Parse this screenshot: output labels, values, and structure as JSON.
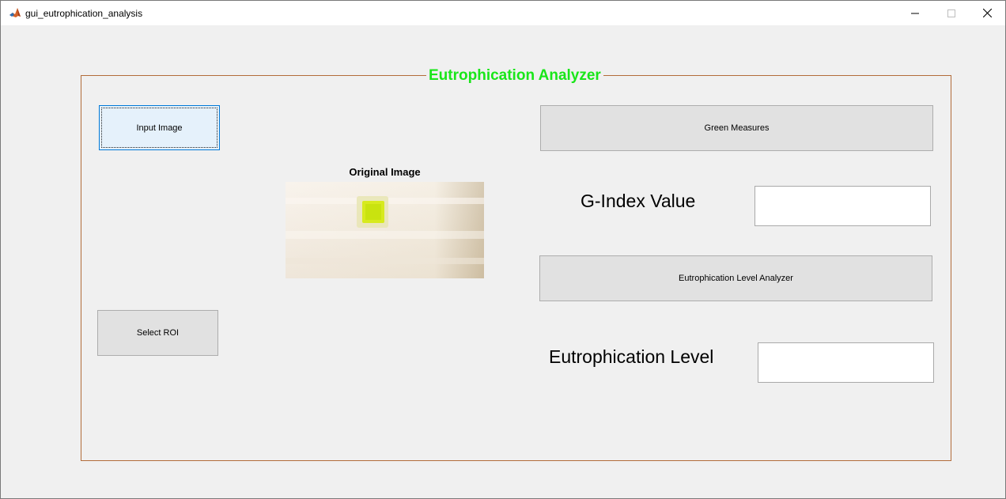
{
  "window": {
    "title": "gui_eutrophication_analysis",
    "controls": [
      "minimize-icon",
      "maximize-icon",
      "close-icon"
    ]
  },
  "panel": {
    "title": "Eutrophication Analyzer",
    "title_color": "#19e619",
    "border_color": "#b26c3a"
  },
  "buttons": {
    "input_image": "Input Image",
    "select_roi": "Select ROI",
    "green_measures": "Green Measures",
    "level_analyzer": "Eutrophication Level Analyzer"
  },
  "axes": {
    "title": "Original Image"
  },
  "fields": {
    "g_index_label": "G-Index Value",
    "g_index_value": "",
    "level_label": "Eutrophication Level",
    "level_value": ""
  }
}
